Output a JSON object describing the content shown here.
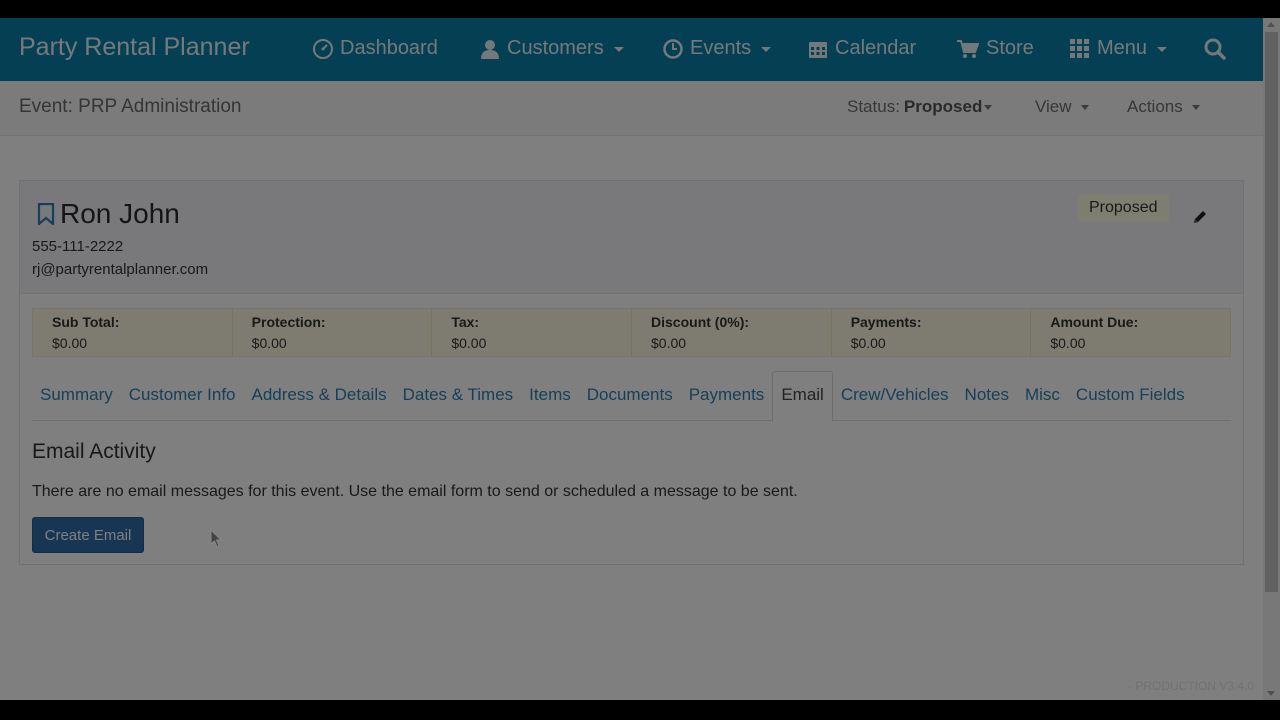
{
  "navbar": {
    "brand": "Party Rental Planner",
    "items": [
      {
        "label": "Dashboard",
        "icon": "dashboard-icon"
      },
      {
        "label": "Customers",
        "icon": "user-icon"
      },
      {
        "label": "Events",
        "icon": "clock-icon"
      },
      {
        "label": "Calendar",
        "icon": "calendar-icon"
      },
      {
        "label": "Store",
        "icon": "cart-icon"
      },
      {
        "label": "Menu",
        "icon": "grid-icon"
      }
    ],
    "search_icon": "search-icon"
  },
  "subheader": {
    "event_title": "Event: PRP Administration",
    "status_label": "Status:",
    "status_value": "Proposed",
    "view_label": "View",
    "actions_label": "Actions"
  },
  "customer": {
    "name": "Ron John",
    "phone": "555-111-2222",
    "email": "rj@partyrentalplanner.com",
    "status_badge": "Proposed"
  },
  "totals": [
    {
      "label": "Sub Total:",
      "value": "$0.00"
    },
    {
      "label": "Protection:",
      "value": "$0.00"
    },
    {
      "label": "Tax:",
      "value": "$0.00"
    },
    {
      "label": "Discount (0%):",
      "value": "$0.00"
    },
    {
      "label": "Payments:",
      "value": "$0.00"
    },
    {
      "label": "Amount Due:",
      "value": "$0.00"
    }
  ],
  "tabs": [
    {
      "label": "Summary",
      "active": false
    },
    {
      "label": "Customer Info",
      "active": false
    },
    {
      "label": "Address & Details",
      "active": false
    },
    {
      "label": "Dates & Times",
      "active": false
    },
    {
      "label": "Items",
      "active": false
    },
    {
      "label": "Documents",
      "active": false
    },
    {
      "label": "Payments",
      "active": false
    },
    {
      "label": "Email",
      "active": true
    },
    {
      "label": "Crew/Vehicles",
      "active": false
    },
    {
      "label": "Notes",
      "active": false
    },
    {
      "label": "Misc",
      "active": false
    },
    {
      "label": "Custom Fields",
      "active": false
    }
  ],
  "email_section": {
    "title": "Email Activity",
    "message": "There are no email messages for this event. Use the email form to send or scheduled a message to be sent.",
    "create_button": "Create Email"
  },
  "footer": {
    "version": "- PRODUCTION V3.4.0"
  },
  "colors": {
    "navbar": "#0a7fa8",
    "link": "#2f7fb2",
    "button": "#2d6ca8",
    "totals_bg": "#fcf8e1",
    "badge_bg": "#fdfce0"
  }
}
